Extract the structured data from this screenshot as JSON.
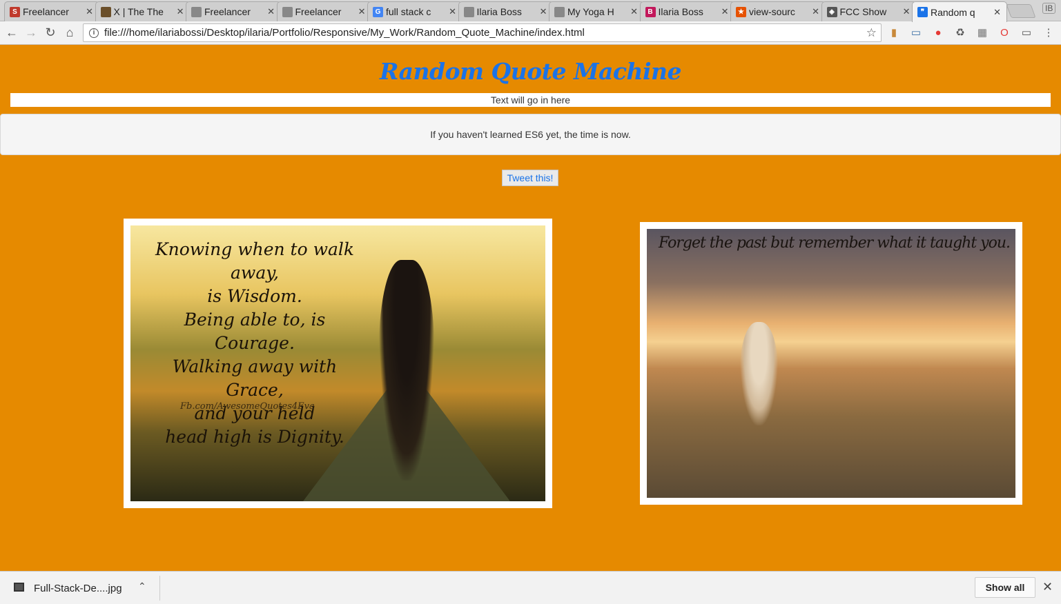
{
  "browser": {
    "tabs": [
      {
        "title": "Freelancer",
        "favicon_color": "#c0392b",
        "favicon_letter": "S"
      },
      {
        "title": "X | The The",
        "favicon_color": "#6b4f2a",
        "favicon_letter": ""
      },
      {
        "title": "Freelancer",
        "favicon_color": "#888888",
        "favicon_letter": ""
      },
      {
        "title": "Freelancer",
        "favicon_color": "#888888",
        "favicon_letter": ""
      },
      {
        "title": "full stack c",
        "favicon_color": "#4285f4",
        "favicon_letter": "G"
      },
      {
        "title": "Ilaria Boss",
        "favicon_color": "#888888",
        "favicon_letter": ""
      },
      {
        "title": "My Yoga H",
        "favicon_color": "#888888",
        "favicon_letter": ""
      },
      {
        "title": "Ilaria Boss",
        "favicon_color": "#c2185b",
        "favicon_letter": "B"
      },
      {
        "title": "view-sourc",
        "favicon_color": "#e65100",
        "favicon_letter": "★"
      },
      {
        "title": "FCC Show",
        "favicon_color": "#555555",
        "favicon_letter": "◈"
      },
      {
        "title": "Random q",
        "favicon_color": "#1a73e8",
        "favicon_letter": "❞"
      }
    ],
    "active_tab_index": 10,
    "url": "file:///home/ilariabossi/Desktop/ilaria/Portfolio/Responsive/My_Work/Random_Quote_Machine/index.html",
    "profile_label": "IB"
  },
  "page": {
    "title": "Random Quote Machine",
    "text_bar": "Text will go in here",
    "quote": "If you haven't learned ES6 yet, the time is now.",
    "tweet_button": "Tweet this!",
    "image1": {
      "lines": [
        "Knowing when to walk away,",
        "is Wisdom.",
        "Being able to, is Courage.",
        "Walking away with Grace,",
        "and your held",
        "head high is Dignity."
      ],
      "credit": "Fb.com/AwesomeQuotes4Eva"
    },
    "image2": {
      "text": "Forget the past but remember what it taught you."
    }
  },
  "downloads": {
    "file_name": "Full-Stack-De....jpg",
    "show_all": "Show all"
  },
  "colors": {
    "page_background": "#e68a00",
    "title_color": "#1a73e8",
    "link_color": "#1a73e8"
  }
}
